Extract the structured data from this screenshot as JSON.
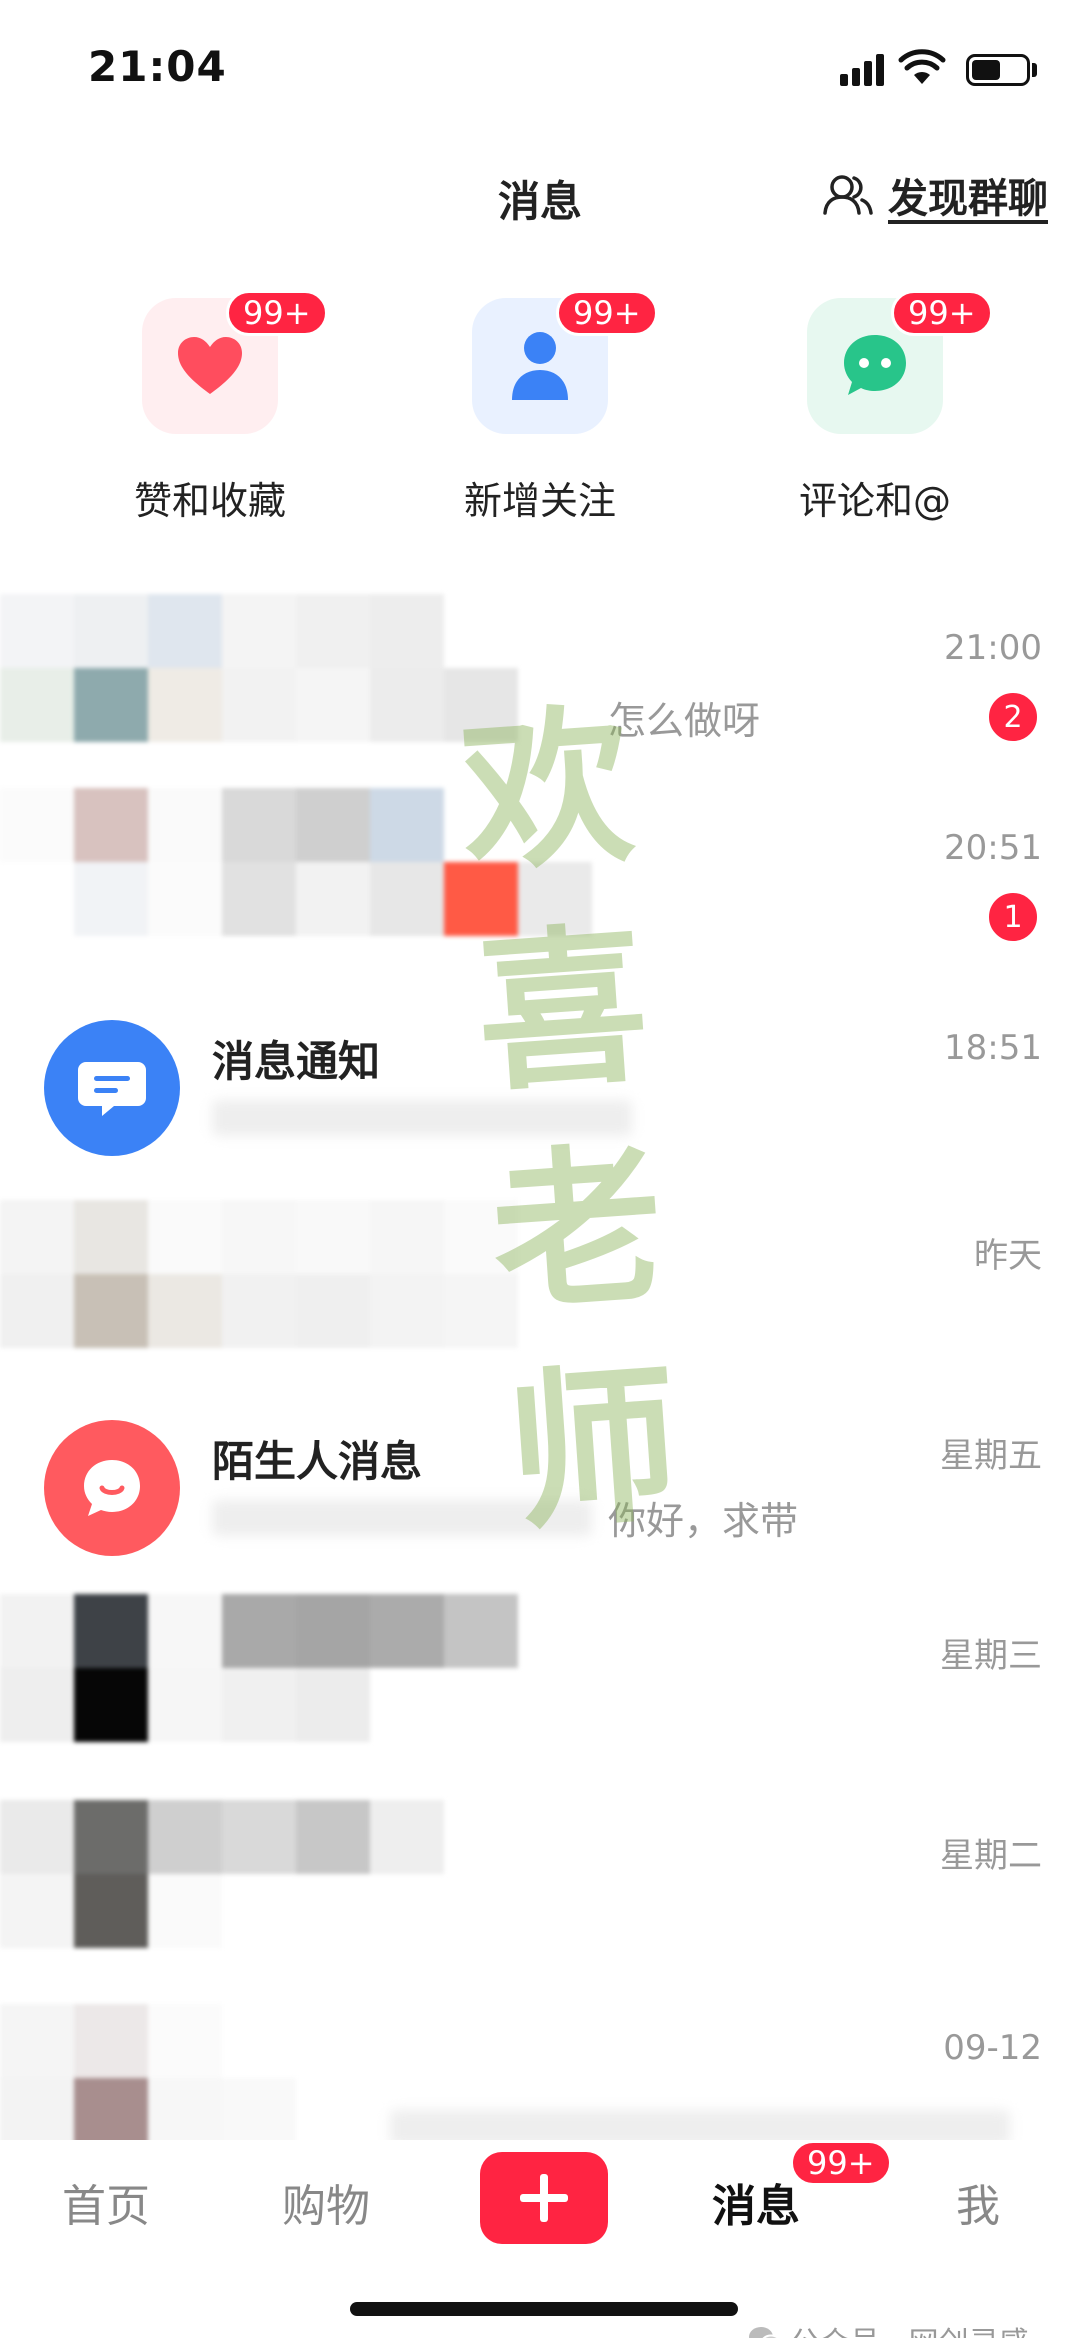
{
  "status_bar": {
    "time": "21:04"
  },
  "header": {
    "title": "消息",
    "discover_label": "发现群聊"
  },
  "quick_tiles": [
    {
      "label": "赞和收藏",
      "badge": "99+",
      "icon": "heart-icon",
      "color": "#ff4d5e",
      "bg": "#ffeef0"
    },
    {
      "label": "新增关注",
      "badge": "99+",
      "icon": "person-icon",
      "color": "#3b82f6",
      "bg": "#e9f1ff"
    },
    {
      "label": "评论和@",
      "badge": "99+",
      "icon": "chat-bubble-icon",
      "color": "#28c58a",
      "bg": "#e7f8f0"
    }
  ],
  "messages": [
    {
      "name": "",
      "time": "21:00",
      "preview": "怎么做呀",
      "unread": "2"
    },
    {
      "name": "",
      "time": "20:51",
      "preview": "",
      "unread": "1"
    },
    {
      "name": "消息通知",
      "time": "18:51",
      "preview": "",
      "unread": ""
    },
    {
      "name": "",
      "time": "昨天",
      "preview": "",
      "unread": ""
    },
    {
      "name": "陌生人消息",
      "time": "星期五",
      "preview": "你好，求带",
      "unread": ""
    },
    {
      "name": "",
      "time": "星期三",
      "preview": "",
      "unread": ""
    },
    {
      "name": "",
      "time": "星期二",
      "preview": "",
      "unread": ""
    },
    {
      "name": "",
      "time": "09-12",
      "preview": "",
      "unread": ""
    }
  ],
  "watermark": "欢喜老师",
  "tabbar": {
    "home": "首页",
    "shop": "购物",
    "messages": "消息",
    "messages_badge": "99+",
    "me": "我"
  },
  "credit": "公众号 · 网创灵感"
}
